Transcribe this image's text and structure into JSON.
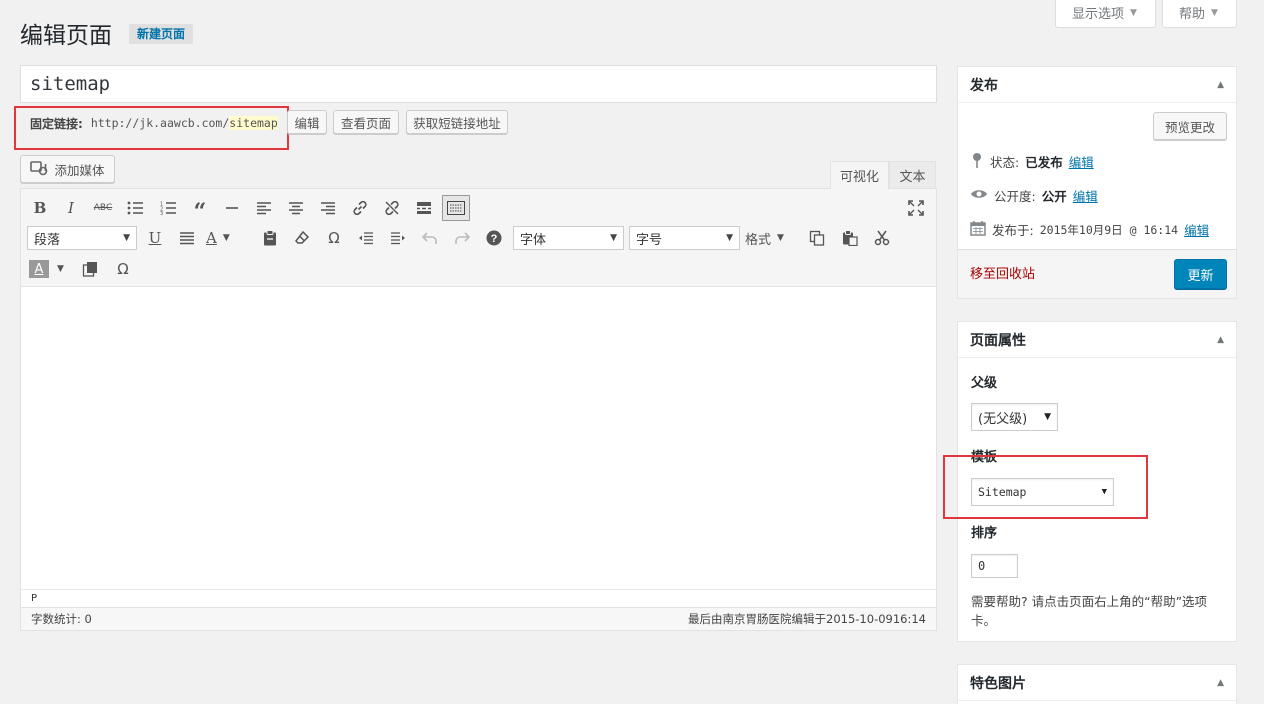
{
  "screen_options": {
    "display_label": "显示选项",
    "help_label": "帮助"
  },
  "header": {
    "title": "编辑页面",
    "new_page_label": "新建页面"
  },
  "post": {
    "title": "sitemap"
  },
  "permalink": {
    "label": "固定链接:",
    "url_base": "http://jk.aawcb.com/",
    "slug": "sitemap",
    "edit_label": "编辑",
    "view_label": "查看页面",
    "shortlink_label": "获取短链接地址"
  },
  "editor": {
    "add_media_label": "添加媒体",
    "tab_visual": "可视化",
    "tab_text": "文本",
    "paragraph_select": "段落",
    "font_select": "字体",
    "size_select": "字号",
    "format_label": "格式",
    "path": "P",
    "word_count": "字数统计: 0",
    "last_edited": "最后由南京胃肠医院编辑于2015-10-0916:14"
  },
  "publish": {
    "title": "发布",
    "preview_label": "预览更改",
    "status_label": "状态:",
    "status_value": "已发布",
    "visibility_label": "公开度:",
    "visibility_value": "公开",
    "published_label": "发布于:",
    "published_value": "2015年10月9日 @ 16:14",
    "edit_label": "编辑",
    "trash_label": "移至回收站",
    "update_label": "更新"
  },
  "page_attributes": {
    "title": "页面属性",
    "parent_label": "父级",
    "parent_value": "(无父级)",
    "template_label": "模板",
    "template_value": "Sitemap",
    "order_label": "排序",
    "order_value": "0",
    "help_text": "需要帮助? 请点击页面右上角的“帮助”选项卡。"
  },
  "featured_image": {
    "title": "特色图片"
  },
  "colors": {
    "accent": "#0085ba",
    "highlight": "#e0363c",
    "link": "#0073aa"
  }
}
